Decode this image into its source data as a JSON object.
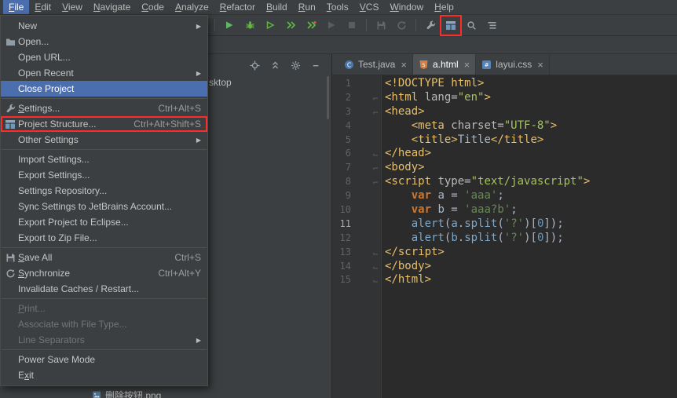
{
  "colors": {
    "selection_blue": "#4B6EAF",
    "annotation_red": "#FF2B2B",
    "editor_bg": "#2B2B2B",
    "panel_bg": "#3C3F41"
  },
  "menubar": {
    "items": [
      {
        "label": "File",
        "u": 0,
        "active": true
      },
      {
        "label": "Edit",
        "u": 0
      },
      {
        "label": "View",
        "u": 0
      },
      {
        "label": "Navigate",
        "u": 0
      },
      {
        "label": "Code",
        "u": 0
      },
      {
        "label": "Analyze",
        "u": 0
      },
      {
        "label": "Refactor",
        "u": 0
      },
      {
        "label": "Build",
        "u": 0
      },
      {
        "label": "Run",
        "u": 0
      },
      {
        "label": "Tools",
        "u": 0
      },
      {
        "label": "VCS",
        "u": 0
      },
      {
        "label": "Window",
        "u": 0
      },
      {
        "label": "Help",
        "u": 0
      }
    ]
  },
  "toolbar": {
    "icons": [
      {
        "type": "separator"
      },
      {
        "name": "run-icon"
      },
      {
        "name": "debug-icon"
      },
      {
        "name": "run-coverage-icon"
      },
      {
        "name": "jrebel-run-icon"
      },
      {
        "name": "jrebel-debug-icon"
      },
      {
        "name": "rerun-icon",
        "disabled": true
      },
      {
        "name": "stop-icon",
        "disabled": true
      },
      {
        "type": "separator"
      },
      {
        "name": "save-all-icon",
        "disabled": true
      },
      {
        "name": "synchronize-icon",
        "disabled": true
      },
      {
        "type": "separator"
      },
      {
        "name": "settings-icon"
      },
      {
        "name": "project-structure-icon",
        "redbox": true
      },
      {
        "name": "search-icon"
      },
      {
        "name": "structure-list-icon"
      }
    ]
  },
  "file_menu": {
    "items": [
      {
        "label": "New",
        "submenu": true
      },
      {
        "label": "Open...",
        "icon": "folder-icon"
      },
      {
        "label": "Open URL..."
      },
      {
        "label": "Open Recent",
        "submenu": true
      },
      {
        "label": "Close Project",
        "selected": true
      },
      {
        "type": "separator"
      },
      {
        "label": "Settings...",
        "shortcut": "Ctrl+Alt+S",
        "icon": "wrench-icon",
        "u": 0
      },
      {
        "label": "Project Structure...",
        "shortcut": "Ctrl+Alt+Shift+S",
        "icon": "project-structure-icon",
        "redbox": true
      },
      {
        "label": "Other Settings",
        "submenu": true
      },
      {
        "type": "separator"
      },
      {
        "label": "Import Settings..."
      },
      {
        "label": "Export Settings..."
      },
      {
        "label": "Settings Repository..."
      },
      {
        "label": "Sync Settings to JetBrains Account..."
      },
      {
        "label": "Export Project to Eclipse..."
      },
      {
        "label": "Export to Zip File..."
      },
      {
        "type": "separator"
      },
      {
        "label": "Save All",
        "shortcut": "Ctrl+S",
        "icon": "save-all-icon",
        "u": 0
      },
      {
        "label": "Synchronize",
        "shortcut": "Ctrl+Alt+Y",
        "icon": "synchronize-icon",
        "u": 0
      },
      {
        "label": "Invalidate Caches / Restart..."
      },
      {
        "type": "separator"
      },
      {
        "label": "Print...",
        "disabled": true,
        "u": 0
      },
      {
        "label": "Associate with File Type...",
        "disabled": true
      },
      {
        "label": "Line Separators",
        "submenu": true,
        "disabled": true
      },
      {
        "type": "separator"
      },
      {
        "label": "Power Save Mode"
      },
      {
        "label": "Exit",
        "u": 1
      }
    ]
  },
  "panel_toolbar": {
    "icons": [
      {
        "name": "locate-icon"
      },
      {
        "name": "collapse-all-icon"
      },
      {
        "name": "gear-icon"
      },
      {
        "name": "hide-icon"
      }
    ]
  },
  "project_panel": {
    "visible_text": "sktop",
    "bottom_item": {
      "label": "删除按钮.png",
      "icon": "image-file-icon"
    }
  },
  "tabs": [
    {
      "label": "Test.java",
      "icon": "java-file-icon",
      "close": "×"
    },
    {
      "label": "a.html",
      "icon": "html-file-icon",
      "close": "×",
      "active": true
    },
    {
      "label": "layui.css",
      "icon": "css-file-icon",
      "close": "×"
    }
  ],
  "editor": {
    "current_line": 11,
    "lines": [
      {
        "no": 1,
        "fold": "",
        "tokens": [
          [
            "<!DOCTYPE html>",
            "tag"
          ]
        ]
      },
      {
        "no": 2,
        "fold": "start",
        "tokens": [
          [
            "<html ",
            "tag"
          ],
          [
            "lang=",
            "attr"
          ],
          [
            "\"en\"",
            "value"
          ],
          [
            ">",
            "tag"
          ]
        ]
      },
      {
        "no": 3,
        "fold": "start",
        "tokens": [
          [
            "<head>",
            "tag"
          ]
        ]
      },
      {
        "no": 4,
        "fold": "",
        "tokens": [
          [
            "    ",
            "plain"
          ],
          [
            "<meta ",
            "tag"
          ],
          [
            "charset=",
            "attr"
          ],
          [
            "\"UTF-8\"",
            "value"
          ],
          [
            ">",
            "tag"
          ]
        ]
      },
      {
        "no": 5,
        "fold": "",
        "tokens": [
          [
            "    ",
            "plain"
          ],
          [
            "<title>",
            "tag"
          ],
          [
            "Title",
            "plain"
          ],
          [
            "</title>",
            "tag"
          ]
        ]
      },
      {
        "no": 6,
        "fold": "end",
        "tokens": [
          [
            "</head>",
            "tag"
          ]
        ]
      },
      {
        "no": 7,
        "fold": "start",
        "tokens": [
          [
            "<body>",
            "tag"
          ]
        ]
      },
      {
        "no": 8,
        "fold": "start",
        "tokens": [
          [
            "<script ",
            "tag"
          ],
          [
            "type=",
            "attr"
          ],
          [
            "\"text/javascript\"",
            "value"
          ],
          [
            ">",
            "tag"
          ]
        ]
      },
      {
        "no": 9,
        "fold": "",
        "tokens": [
          [
            "    ",
            "plain"
          ],
          [
            "var",
            "keyword"
          ],
          [
            " a = ",
            "plain"
          ],
          [
            "'aaa'",
            "string"
          ],
          [
            ";",
            "plain"
          ]
        ]
      },
      {
        "no": 10,
        "fold": "",
        "tokens": [
          [
            "    ",
            "plain"
          ],
          [
            "var",
            "keyword"
          ],
          [
            " b = ",
            "plain"
          ],
          [
            "'aaa?b'",
            "string"
          ],
          [
            ";",
            "plain"
          ]
        ]
      },
      {
        "no": 11,
        "fold": "",
        "tokens": [
          [
            "    ",
            "plain"
          ],
          [
            "alert",
            "fn"
          ],
          [
            "(",
            "plain"
          ],
          [
            "a",
            "fn"
          ],
          [
            ".",
            "plain"
          ],
          [
            "split",
            "fn"
          ],
          [
            "(",
            "plain"
          ],
          [
            "'?'",
            "string"
          ],
          [
            ")[",
            "plain"
          ],
          [
            "0",
            "number"
          ],
          [
            "]);",
            "plain"
          ]
        ]
      },
      {
        "no": 12,
        "fold": "",
        "tokens": [
          [
            "    ",
            "plain"
          ],
          [
            "alert",
            "fn"
          ],
          [
            "(",
            "plain"
          ],
          [
            "b",
            "fn"
          ],
          [
            ".",
            "plain"
          ],
          [
            "split",
            "fn"
          ],
          [
            "(",
            "plain"
          ],
          [
            "'?'",
            "string"
          ],
          [
            ")[",
            "plain"
          ],
          [
            "0",
            "number"
          ],
          [
            "]);",
            "plain"
          ]
        ]
      },
      {
        "no": 13,
        "fold": "end",
        "tokens": [
          [
            "</script>",
            "tag"
          ]
        ]
      },
      {
        "no": 14,
        "fold": "end",
        "tokens": [
          [
            "</body>",
            "tag"
          ]
        ]
      },
      {
        "no": 15,
        "fold": "end",
        "tokens": [
          [
            "</html>",
            "tag"
          ]
        ]
      }
    ]
  }
}
